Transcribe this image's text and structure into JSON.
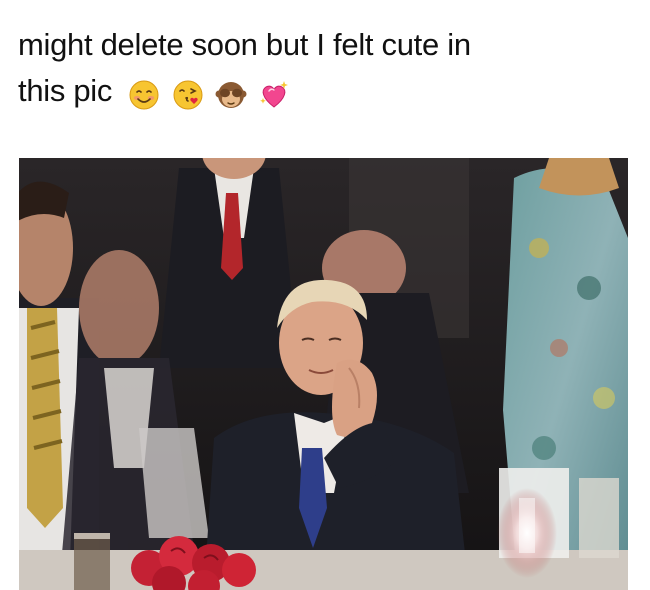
{
  "post": {
    "caption_line1": "might delete soon but I felt cute in",
    "caption_line2": "this pic",
    "emojis": [
      "smiling-blush-emoji",
      "kiss-face-emoji",
      "see-no-evil-monkey-emoji",
      "sparkling-heart-emoji"
    ]
  },
  "photo": {
    "subject": "man-in-suit-resting-chin-on-hand",
    "background_color": "#1b1a1c"
  }
}
